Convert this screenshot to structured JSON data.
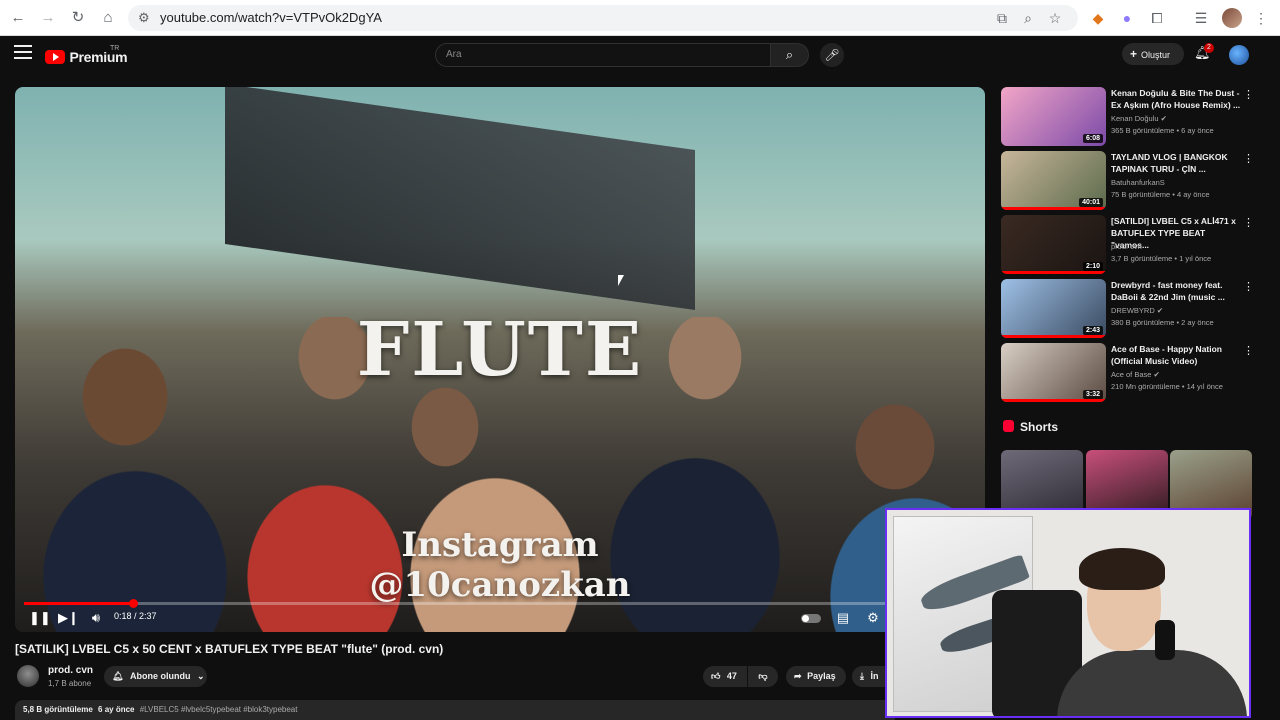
{
  "browser": {
    "url": "youtube.com/watch?v=VTPvOk2DgYA"
  },
  "masthead": {
    "logo_text": "Premium",
    "region": "TR",
    "search_placeholder": "Ara",
    "create_label": "Oluştur",
    "notification_count": "2"
  },
  "player": {
    "overlay_main": "FLUTE",
    "overlay_line1": "Instagram",
    "overlay_line2": "@10canozkan",
    "current_time": "0:18",
    "duration": "2:37",
    "time_display": "0:18 / 2:37",
    "progress_fraction": 0.114
  },
  "video": {
    "title": "[SATILIK] LVBEL C5 x 50 CENT x BATUFLEX TYPE BEAT \"flute\" (prod. cvn)",
    "channel": "prod. cvn",
    "subscribers": "1,7 B abone",
    "subscribe_label": "Abone olundu",
    "likes": "47",
    "share_label": "Paylaş",
    "download_label": "İn",
    "views": "5,8 B görüntüleme",
    "age": "6 ay önce",
    "tags": "#LVBELC5 #lvbelc5typebeat #blok3typebeat"
  },
  "recommendations": [
    {
      "title": "Kenan Doğulu & Bite The Dust - Ex Aşkım (Afro House Remix) ...",
      "channel": "Kenan Doğulu",
      "verified": true,
      "meta": "365 B görüntüleme • 6 ay önce",
      "duration": "6:08",
      "colors": [
        "#f2a6c7",
        "#7b4aa8"
      ],
      "watched_fraction": 0
    },
    {
      "title": "TAYLAND VLOG | BANGKOK TAPINAK TURU - ÇİN ...",
      "channel": "BatuhanfurkanS",
      "verified": false,
      "meta": "75 B görüntüleme • 4 ay önce",
      "duration": "40:01",
      "colors": [
        "#c7b69a",
        "#5c6a4c"
      ],
      "watched_fraction": 1
    },
    {
      "title": "[SATILDI] LVBEL C5 x ALİ471 x BATUFLEX TYPE BEAT \"vamos...",
      "channel": "prod. cvn",
      "verified": false,
      "meta": "3,7 B görüntüleme • 1 yıl önce",
      "duration": "2:10",
      "colors": [
        "#3a2a22",
        "#1a1412"
      ],
      "watched_fraction": 1
    },
    {
      "title": "Drewbyrd - fast money feat. DaBoii & 22nd Jim (music ...",
      "channel": "DREWBYRD",
      "verified": true,
      "meta": "380 B görüntüleme • 2 ay önce",
      "duration": "2:43",
      "colors": [
        "#9ec0e6",
        "#3a4a60"
      ],
      "watched_fraction": 1
    },
    {
      "title": "Ace of Base - Happy Nation (Official Music Video)",
      "channel": "Ace of Base",
      "verified": true,
      "meta": "210 Mn görüntüleme • 14 yıl önce",
      "duration": "3:32",
      "colors": [
        "#d9cfc4",
        "#5a4a42"
      ],
      "watched_fraction": 1
    }
  ],
  "shorts": {
    "heading": "Shorts",
    "items": [
      {
        "colors": [
          "#6f6a78",
          "#2c2933"
        ]
      },
      {
        "colors": [
          "#c84f7a",
          "#2a1a1f"
        ]
      },
      {
        "colors": [
          "#9aa08a",
          "#5a3f2e"
        ]
      }
    ]
  },
  "colors": {
    "accent_red": "#ff0000",
    "background": "#0f0f0f",
    "webcam_border": "#6a2ff5"
  }
}
